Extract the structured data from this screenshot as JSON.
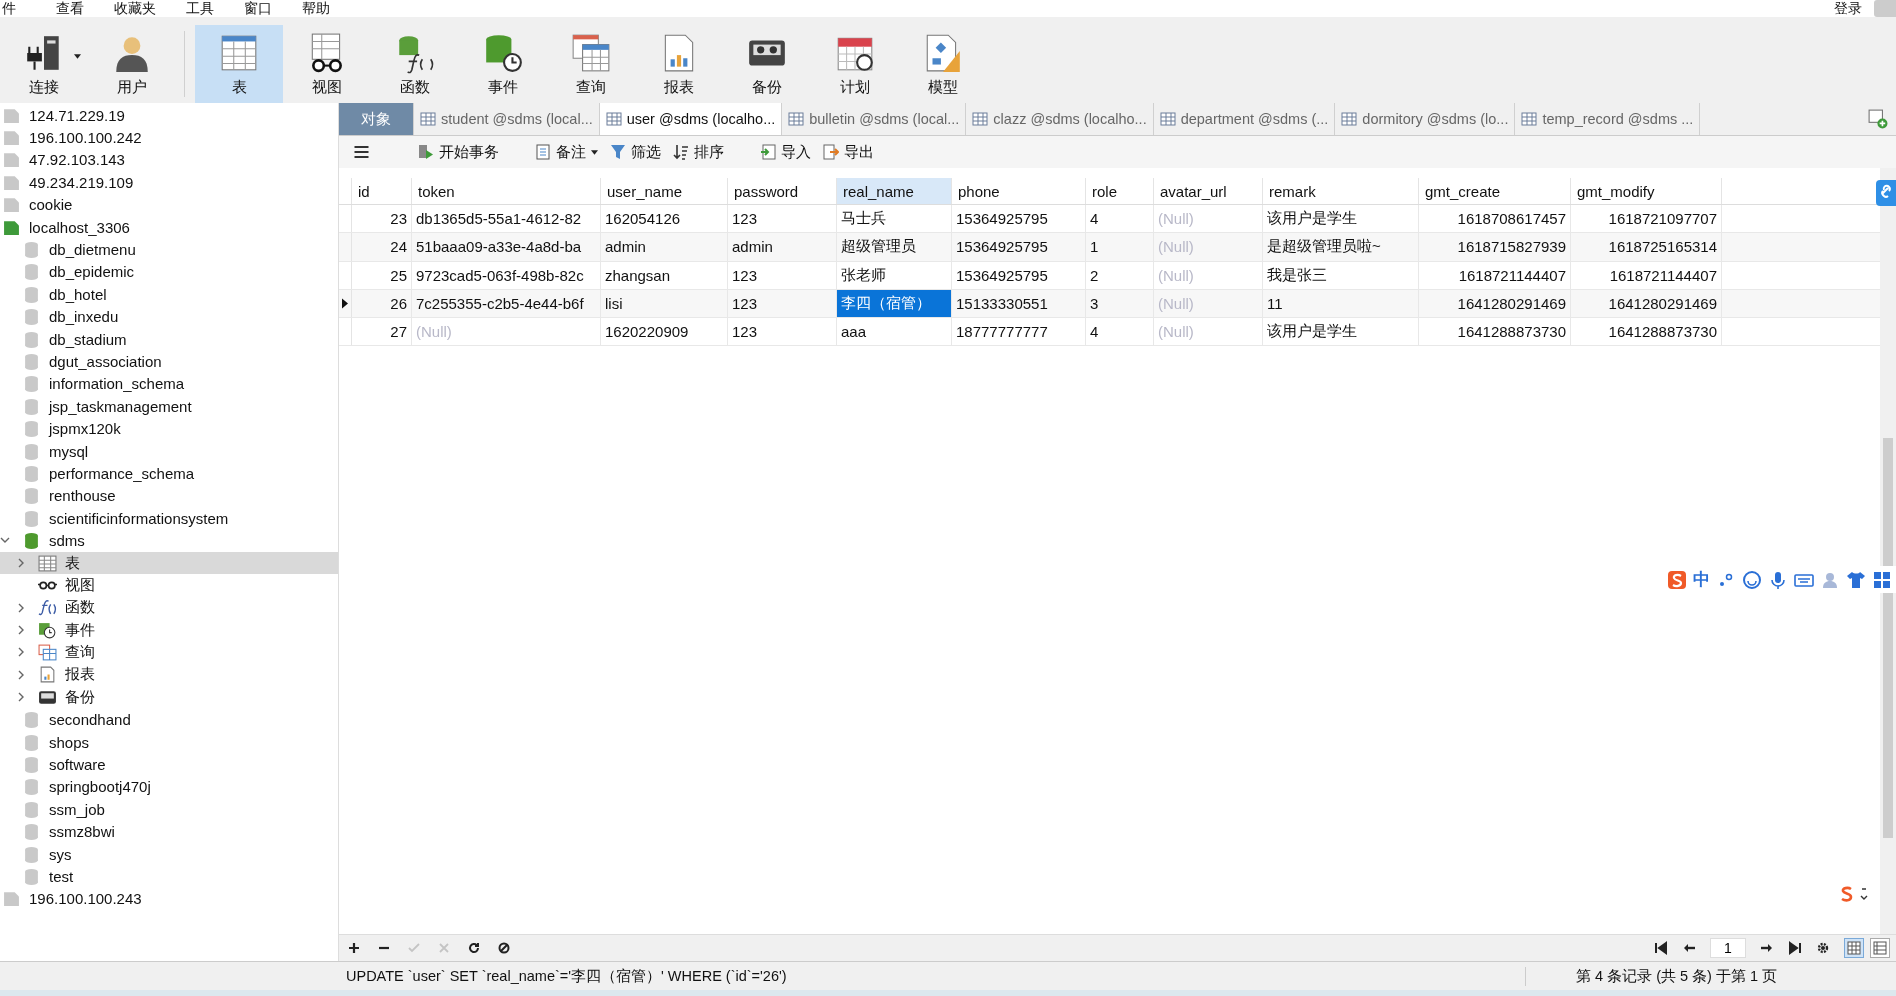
{
  "menu_bar": {
    "items": [
      "件",
      "查看",
      "收藏夹",
      "工具",
      "窗口",
      "帮助"
    ],
    "login": "登录"
  },
  "toolbar": [
    {
      "label": "连接",
      "kind": "connection",
      "selected": false
    },
    {
      "label": "用户",
      "kind": "user",
      "selected": false
    },
    {
      "label": "表",
      "kind": "table",
      "selected": true
    },
    {
      "label": "视图",
      "kind": "view",
      "selected": false
    },
    {
      "label": "函数",
      "kind": "function",
      "selected": false
    },
    {
      "label": "事件",
      "kind": "event",
      "selected": false
    },
    {
      "label": "查询",
      "kind": "query",
      "selected": false
    },
    {
      "label": "报表",
      "kind": "report",
      "selected": false
    },
    {
      "label": "备份",
      "kind": "backup",
      "selected": false
    },
    {
      "label": "计划",
      "kind": "schedule",
      "selected": false
    },
    {
      "label": "模型",
      "kind": "model",
      "selected": false
    }
  ],
  "sidebar": {
    "items": [
      {
        "label": "124.71.229.19",
        "kind": "connection",
        "connected": false,
        "selected": false
      },
      {
        "label": "196.100.100.242",
        "kind": "connection",
        "connected": false,
        "selected": false
      },
      {
        "label": "47.92.103.143",
        "kind": "connection",
        "connected": false,
        "selected": false
      },
      {
        "label": "49.234.219.109",
        "kind": "connection",
        "connected": false,
        "selected": false
      },
      {
        "label": "cookie",
        "kind": "connection",
        "connected": false,
        "selected": false
      },
      {
        "label": "localhost_3306",
        "kind": "connection",
        "connected": true,
        "selected": false,
        "children": [
          {
            "label": "db_dietmenu",
            "kind": "db",
            "open": false,
            "selected": false
          },
          {
            "label": "db_epidemic",
            "kind": "db",
            "open": false,
            "selected": false
          },
          {
            "label": "db_hotel",
            "kind": "db",
            "open": false,
            "selected": false
          },
          {
            "label": "db_inxedu",
            "kind": "db",
            "open": false,
            "selected": false
          },
          {
            "label": "db_stadium",
            "kind": "db",
            "open": false,
            "selected": false
          },
          {
            "label": "dgut_association",
            "kind": "db",
            "open": false,
            "selected": false
          },
          {
            "label": "information_schema",
            "kind": "db",
            "open": false,
            "selected": false
          },
          {
            "label": "jsp_taskmanagement",
            "kind": "db",
            "open": false,
            "selected": false
          },
          {
            "label": "jspmx120k",
            "kind": "db",
            "open": false,
            "selected": false
          },
          {
            "label": "mysql",
            "kind": "db",
            "open": false,
            "selected": false
          },
          {
            "label": "performance_schema",
            "kind": "db",
            "open": false,
            "selected": false
          },
          {
            "label": "renthouse",
            "kind": "db",
            "open": false,
            "selected": false
          },
          {
            "label": "scientificinformationsystem",
            "kind": "db",
            "open": false,
            "selected": false
          },
          {
            "label": "sdms",
            "kind": "db",
            "open": true,
            "expanded": true,
            "selected": false,
            "children": [
              {
                "label": "表",
                "kind": "table",
                "expanded": false,
                "selected": true
              },
              {
                "label": "视图",
                "kind": "view",
                "selected": false
              },
              {
                "label": "函数",
                "kind": "function",
                "expanded": false,
                "selected": false
              },
              {
                "label": "事件",
                "kind": "event",
                "expanded": false,
                "selected": false
              },
              {
                "label": "查询",
                "kind": "query",
                "expanded": false,
                "selected": false
              },
              {
                "label": "报表",
                "kind": "report",
                "expanded": false,
                "selected": false
              },
              {
                "label": "备份",
                "kind": "backup",
                "expanded": false,
                "selected": false
              }
            ]
          },
          {
            "label": "secondhand",
            "kind": "db",
            "open": false,
            "selected": false
          },
          {
            "label": "shops",
            "kind": "db",
            "open": false,
            "selected": false
          },
          {
            "label": "software",
            "kind": "db",
            "open": false,
            "selected": false
          },
          {
            "label": "springbootj470j",
            "kind": "db",
            "open": false,
            "selected": false
          },
          {
            "label": "ssm_job",
            "kind": "db",
            "open": false,
            "selected": false
          },
          {
            "label": "ssmz8bwi",
            "kind": "db",
            "open": false,
            "selected": false
          },
          {
            "label": "sys",
            "kind": "db",
            "open": false,
            "selected": false
          },
          {
            "label": "test",
            "kind": "db",
            "open": false,
            "selected": false
          }
        ]
      },
      {
        "label": "196.100.100.243",
        "kind": "connection",
        "connected": false,
        "selected": false
      }
    ]
  },
  "tabs": [
    {
      "label": "对象",
      "kind": "objects",
      "selected": false
    },
    {
      "label": "student @sdms (local...",
      "kind": "table",
      "selected": false
    },
    {
      "label": "user @sdms (localho...",
      "kind": "table",
      "selected": true
    },
    {
      "label": "bulletin @sdms (local...",
      "kind": "table",
      "selected": false
    },
    {
      "label": "clazz @sdms (localho...",
      "kind": "table",
      "selected": false
    },
    {
      "label": "department @sdms (...",
      "kind": "table",
      "selected": false
    },
    {
      "label": "dormitory @sdms (lo...",
      "kind": "table",
      "selected": false
    },
    {
      "label": "temp_record @sdms ...",
      "kind": "table",
      "selected": false
    }
  ],
  "table_toolbar": [
    {
      "label": "开始事务",
      "kind": "transaction"
    },
    {
      "label": "备注",
      "kind": "note"
    },
    {
      "label": "筛选",
      "kind": "filter"
    },
    {
      "label": "排序",
      "kind": "sort"
    },
    {
      "label": "导入",
      "kind": "import"
    },
    {
      "label": "导出",
      "kind": "export"
    }
  ],
  "table": {
    "columns": [
      {
        "name": "id",
        "kind": "number",
        "selected": false
      },
      {
        "name": "token",
        "kind": "text",
        "selected": false
      },
      {
        "name": "user_name",
        "kind": "text",
        "selected": false
      },
      {
        "name": "password",
        "kind": "text",
        "selected": false
      },
      {
        "name": "real_name",
        "kind": "text",
        "selected": true
      },
      {
        "name": "phone",
        "kind": "text",
        "selected": false
      },
      {
        "name": "role",
        "kind": "text",
        "selected": false
      },
      {
        "name": "avatar_url",
        "kind": "text",
        "selected": false
      },
      {
        "name": "remark",
        "kind": "text",
        "selected": false
      },
      {
        "name": "gmt_create",
        "kind": "number",
        "selected": false
      },
      {
        "name": "gmt_modify",
        "kind": "number",
        "selected": false
      }
    ],
    "rows": [
      {
        "current": false,
        "cells": [
          {
            "text": "23",
            "null": false,
            "selected": false
          },
          {
            "text": "db1365d5-55a1-4612-82",
            "null": false,
            "selected": false
          },
          {
            "text": "162054126",
            "null": false,
            "selected": false
          },
          {
            "text": "123",
            "null": false,
            "selected": false
          },
          {
            "text": "马士兵",
            "null": false,
            "selected": false
          },
          {
            "text": "15364925795",
            "null": false,
            "selected": false
          },
          {
            "text": "4",
            "null": false,
            "selected": false
          },
          {
            "text": "(Null)",
            "null": true,
            "selected": false
          },
          {
            "text": "该用户是学生",
            "null": false,
            "selected": false
          },
          {
            "text": "1618708617457",
            "null": false,
            "selected": false
          },
          {
            "text": "1618721097707",
            "null": false,
            "selected": false
          }
        ]
      },
      {
        "current": false,
        "cells": [
          {
            "text": "24",
            "null": false,
            "selected": false
          },
          {
            "text": "51baaa09-a33e-4a8d-ba",
            "null": false,
            "selected": false
          },
          {
            "text": "admin",
            "null": false,
            "selected": false
          },
          {
            "text": "admin",
            "null": false,
            "selected": false
          },
          {
            "text": "超级管理员",
            "null": false,
            "selected": false
          },
          {
            "text": "15364925795",
            "null": false,
            "selected": false
          },
          {
            "text": "1",
            "null": false,
            "selected": false
          },
          {
            "text": "(Null)",
            "null": true,
            "selected": false
          },
          {
            "text": "是超级管理员啦~",
            "null": false,
            "selected": false
          },
          {
            "text": "1618715827939",
            "null": false,
            "selected": false
          },
          {
            "text": "1618725165314",
            "null": false,
            "selected": false
          }
        ]
      },
      {
        "current": false,
        "cells": [
          {
            "text": "25",
            "null": false,
            "selected": false
          },
          {
            "text": "9723cad5-063f-498b-82c",
            "null": false,
            "selected": false
          },
          {
            "text": "zhangsan",
            "null": false,
            "selected": false
          },
          {
            "text": "123",
            "null": false,
            "selected": false
          },
          {
            "text": "张老师",
            "null": false,
            "selected": false
          },
          {
            "text": "15364925795",
            "null": false,
            "selected": false
          },
          {
            "text": "2",
            "null": false,
            "selected": false
          },
          {
            "text": "(Null)",
            "null": true,
            "selected": false
          },
          {
            "text": "我是张三",
            "null": false,
            "selected": false
          },
          {
            "text": "1618721144407",
            "null": false,
            "selected": false
          },
          {
            "text": "1618721144407",
            "null": false,
            "selected": false
          }
        ]
      },
      {
        "current": true,
        "cells": [
          {
            "text": "26",
            "null": false,
            "selected": false
          },
          {
            "text": "7c255355-c2b5-4e44-b6f",
            "null": false,
            "selected": false
          },
          {
            "text": "lisi",
            "null": false,
            "selected": false
          },
          {
            "text": "123",
            "null": false,
            "selected": false
          },
          {
            "text": "李四（宿管）",
            "null": false,
            "selected": true
          },
          {
            "text": "15133330551",
            "null": false,
            "selected": false
          },
          {
            "text": "3",
            "null": false,
            "selected": false
          },
          {
            "text": "(Null)",
            "null": true,
            "selected": false
          },
          {
            "text": "11",
            "null": false,
            "selected": false
          },
          {
            "text": "1641280291469",
            "null": false,
            "selected": false
          },
          {
            "text": "1641280291469",
            "null": false,
            "selected": false
          }
        ]
      },
      {
        "current": false,
        "cells": [
          {
            "text": "27",
            "null": false,
            "selected": false
          },
          {
            "text": "(Null)",
            "null": true,
            "selected": false
          },
          {
            "text": "1620220909",
            "null": false,
            "selected": false
          },
          {
            "text": "123",
            "null": false,
            "selected": false
          },
          {
            "text": "aaa",
            "null": false,
            "selected": false
          },
          {
            "text": "18777777777",
            "null": false,
            "selected": false
          },
          {
            "text": "4",
            "null": false,
            "selected": false
          },
          {
            "text": "(Null)",
            "null": true,
            "selected": false
          },
          {
            "text": "该用户是学生",
            "null": false,
            "selected": false
          },
          {
            "text": "1641288873730",
            "null": false,
            "selected": false
          },
          {
            "text": "1641288873730",
            "null": false,
            "selected": false
          }
        ]
      }
    ]
  },
  "ime_bar": {
    "mode": "中"
  },
  "bottom_toolbar": {
    "actions": [
      {
        "kind": "add",
        "disabled": false
      },
      {
        "kind": "remove",
        "disabled": false
      },
      {
        "kind": "apply",
        "disabled": true
      },
      {
        "kind": "cancel",
        "disabled": true
      },
      {
        "kind": "refresh",
        "disabled": false
      },
      {
        "kind": "stop",
        "disabled": false
      }
    ],
    "page": "1",
    "views": [
      {
        "kind": "grid",
        "selected": true
      },
      {
        "kind": "form",
        "selected": false
      }
    ]
  },
  "status_bar": {
    "sql": "UPDATE `user` SET `real_name`='李四（宿管）' WHERE (`id`='26')",
    "records": "第 4 条记录 (共 5 条) 于第 1 页"
  }
}
